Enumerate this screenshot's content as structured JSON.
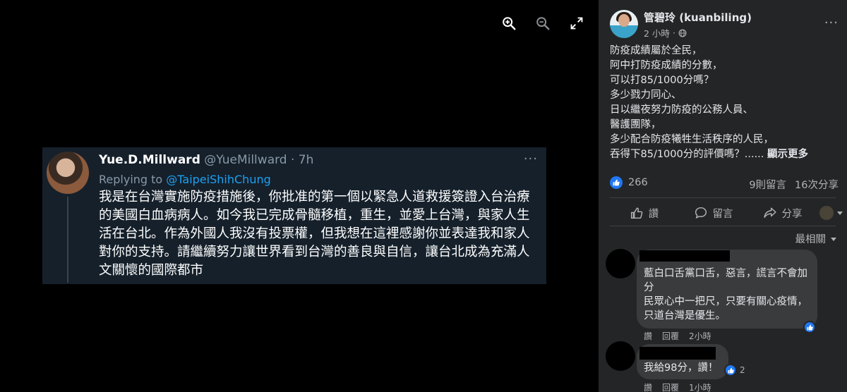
{
  "viewer": {
    "tools": [
      {
        "icon": "zoom-in-icon"
      },
      {
        "icon": "zoom-out-icon"
      },
      {
        "icon": "fullscreen-icon"
      }
    ],
    "tweet": {
      "name": "Yue.D.Millward",
      "handle": "@YueMillward · 7h",
      "more": "···",
      "replying_prefix": "Replying to ",
      "replying_to": "@TaipeiShihChung",
      "body": "我是在台灣實施防疫措施後，你批准的第一個以緊急人道救援簽證入台治療的美國白血病病人。如今我已完成骨髓移植，重生，並愛上台灣，與家人生活在台北。作為外國人我沒有投票權，但我想在這裡感謝你並表達我和家人對你的支持。請繼續努力讓世界看到台灣的善良與自信，讓台北成為充滿人文關懷的國際都市"
    }
  },
  "post": {
    "poster_name": "管碧玲 (kuanbiling)",
    "time": "2 小時",
    "privacy_icon": "globe-icon",
    "options": "···",
    "lines": [
      "防疫成績屬於全民，",
      "阿中打防疫成績的分數，",
      "可以打85/1000分嗎？",
      "多少戮力同心、",
      "日以繼夜努力防疫的公務人員、",
      "醫護團隊，",
      "多少配合防疫犧牲生活秩序的人民，",
      "吞得下85/1000分的評價嗎？......"
    ],
    "see_more": "顯示更多",
    "reaction_count": "266",
    "comments_count": "9則留言",
    "shares_count": "16次分享",
    "actions": {
      "like": "讚",
      "comment": "留言",
      "share": "分享"
    },
    "sort_label": "最相關"
  },
  "comments": [
    {
      "text": "藍白口舌黨口舌，惡言，謊言不會加分\n民眾心中一把尺，只要有關心疫情，只道台灣是優生。",
      "like": "讚",
      "reply": "回覆",
      "time": "2小時",
      "reaction_count": ""
    },
    {
      "text": "我給98分，讚！",
      "like": "讚",
      "reply": "回覆",
      "time": "1小時",
      "reaction_count": "2"
    }
  ],
  "colors": {
    "accent": "#2078f4",
    "panel_bg": "#242526",
    "bubble_bg": "#3a3b3c",
    "tweet_bg": "#15202b",
    "tweet_link": "#1da1f2"
  }
}
